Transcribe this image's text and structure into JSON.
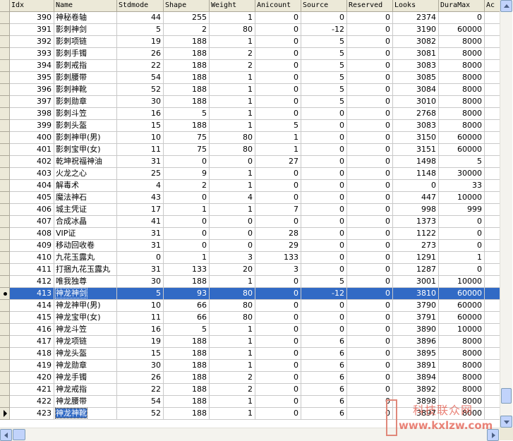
{
  "columns": [
    "Idx",
    "Name",
    "Stdmode",
    "Shape",
    "Weight",
    "Anicount",
    "Source",
    "Reserved",
    "Looks",
    "DuraMax",
    "Ac"
  ],
  "rows": [
    [
      "390",
      "神秘卷轴",
      "44",
      "255",
      "1",
      "0",
      "0",
      "0",
      "2374",
      "0",
      ""
    ],
    [
      "391",
      "影刺神剑",
      "5",
      "2",
      "80",
      "0",
      "-12",
      "0",
      "3190",
      "60000",
      ""
    ],
    [
      "392",
      "影刺项链",
      "19",
      "188",
      "1",
      "0",
      "5",
      "0",
      "3082",
      "8000",
      ""
    ],
    [
      "393",
      "影刺手镯",
      "26",
      "188",
      "2",
      "0",
      "5",
      "0",
      "3081",
      "8000",
      ""
    ],
    [
      "394",
      "影刺戒指",
      "22",
      "188",
      "2",
      "0",
      "5",
      "0",
      "3083",
      "8000",
      ""
    ],
    [
      "395",
      "影刺腰带",
      "54",
      "188",
      "1",
      "0",
      "5",
      "0",
      "3085",
      "8000",
      ""
    ],
    [
      "396",
      "影刺神靴",
      "52",
      "188",
      "1",
      "0",
      "5",
      "0",
      "3084",
      "8000",
      ""
    ],
    [
      "397",
      "影刺勋章",
      "30",
      "188",
      "1",
      "0",
      "5",
      "0",
      "3010",
      "8000",
      ""
    ],
    [
      "398",
      "影刺斗笠",
      "16",
      "5",
      "1",
      "0",
      "0",
      "0",
      "2768",
      "8000",
      ""
    ],
    [
      "399",
      "影刺头盔",
      "15",
      "188",
      "1",
      "5",
      "0",
      "0",
      "3083",
      "8000",
      ""
    ],
    [
      "400",
      "影刺神甲(男)",
      "10",
      "75",
      "80",
      "1",
      "0",
      "0",
      "3150",
      "60000",
      ""
    ],
    [
      "401",
      "影刺宝甲(女)",
      "11",
      "75",
      "80",
      "1",
      "0",
      "0",
      "3151",
      "60000",
      ""
    ],
    [
      "402",
      "乾坤祝福神油",
      "31",
      "0",
      "0",
      "27",
      "0",
      "0",
      "1498",
      "5",
      ""
    ],
    [
      "403",
      "火龙之心",
      "25",
      "9",
      "1",
      "0",
      "0",
      "0",
      "1148",
      "30000",
      ""
    ],
    [
      "404",
      "解毒术",
      "4",
      "2",
      "1",
      "0",
      "0",
      "0",
      "0",
      "33",
      ""
    ],
    [
      "405",
      "魔法神石",
      "43",
      "0",
      "4",
      "0",
      "0",
      "0",
      "447",
      "10000",
      ""
    ],
    [
      "406",
      "城主凭证",
      "17",
      "1",
      "1",
      "7",
      "0",
      "0",
      "998",
      "999",
      ""
    ],
    [
      "407",
      "合成冰晶",
      "41",
      "0",
      "0",
      "0",
      "0",
      "0",
      "1373",
      "0",
      ""
    ],
    [
      "408",
      "VIP证",
      "31",
      "0",
      "0",
      "28",
      "0",
      "0",
      "1122",
      "0",
      ""
    ],
    [
      "409",
      "移动回收卷",
      "31",
      "0",
      "0",
      "29",
      "0",
      "0",
      "273",
      "0",
      ""
    ],
    [
      "410",
      "九花玉露丸",
      "0",
      "1",
      "3",
      "133",
      "0",
      "0",
      "1291",
      "1",
      ""
    ],
    [
      "411",
      "打捆九花玉露丸",
      "31",
      "133",
      "20",
      "3",
      "0",
      "0",
      "1287",
      "0",
      ""
    ],
    [
      "412",
      "唯我独尊",
      "30",
      "188",
      "1",
      "0",
      "5",
      "0",
      "3001",
      "10000",
      ""
    ],
    [
      "413",
      "神龙神剑",
      "5",
      "93",
      "80",
      "0",
      "-12",
      "0",
      "3810",
      "60000",
      ""
    ],
    [
      "414",
      "神龙神甲(男)",
      "10",
      "66",
      "80",
      "0",
      "0",
      "0",
      "3790",
      "60000",
      ""
    ],
    [
      "415",
      "神龙宝甲(女)",
      "11",
      "66",
      "80",
      "0",
      "0",
      "0",
      "3791",
      "60000",
      ""
    ],
    [
      "416",
      "神龙斗笠",
      "16",
      "5",
      "1",
      "0",
      "0",
      "0",
      "3890",
      "10000",
      ""
    ],
    [
      "417",
      "神龙项链",
      "19",
      "188",
      "1",
      "0",
      "6",
      "0",
      "3896",
      "8000",
      ""
    ],
    [
      "418",
      "神龙头盔",
      "15",
      "188",
      "1",
      "0",
      "6",
      "0",
      "3895",
      "8000",
      ""
    ],
    [
      "419",
      "神龙勋章",
      "30",
      "188",
      "1",
      "0",
      "6",
      "0",
      "3891",
      "8000",
      ""
    ],
    [
      "420",
      "神龙手镯",
      "26",
      "188",
      "2",
      "0",
      "6",
      "0",
      "3894",
      "8000",
      ""
    ],
    [
      "421",
      "神龙戒指",
      "22",
      "188",
      "2",
      "0",
      "6",
      "0",
      "3892",
      "8000",
      ""
    ],
    [
      "422",
      "神龙腰带",
      "54",
      "188",
      "1",
      "0",
      "6",
      "0",
      "3898",
      "8000",
      ""
    ],
    [
      "423",
      "神龙神靴",
      "52",
      "188",
      "1",
      "0",
      "6",
      "0",
      "3897",
      "8000",
      ""
    ]
  ],
  "selected_row_idx": "413",
  "editing_row_idx": "423",
  "watermark": {
    "line1": "科技联众网",
    "line2": "www.kxlzw.com"
  },
  "colors": {
    "selection": "#316ac5",
    "header": "#ece9d8",
    "grid": "#c9c9c9",
    "watermark": "#e35a4b"
  }
}
